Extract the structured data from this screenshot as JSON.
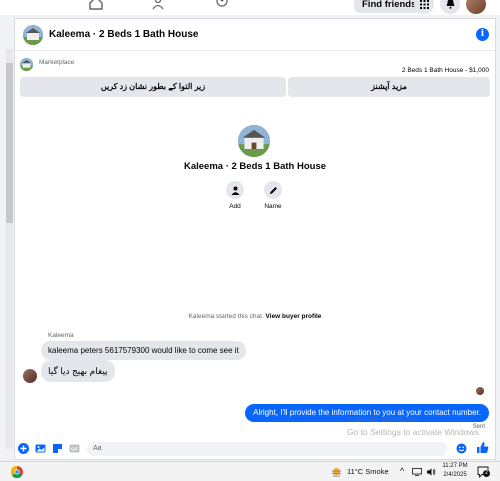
{
  "topbar": {
    "find_friends": "Find friends"
  },
  "chat": {
    "title": "Kaleema · 2 Beds 1 Bath House",
    "marketplace_label": "Marketplace",
    "listing_price": "2 Beds 1 Bath House - $1,000",
    "btn_left": "زیر التوا کے بطور نشان زد کریں",
    "btn_right": "مزید آپشنز",
    "profile_title": "Kaleema · 2 Beds 1 Bath House",
    "add_label": "Add",
    "name_label": "Name",
    "started_prefix": "Kaleema started this chat.",
    "view_profile": "View buyer profile",
    "sender_name": "Kaleema",
    "msg1": "kaleema peters 5617579300 would like to come see it",
    "msg2": "پیغام بھیج دیا گیا",
    "msg_out": "Alright, I'll provide the information to you at your contact number.",
    "sent_label": "Sent",
    "input_placeholder": "Aa",
    "watermark_title": "Activate Windows",
    "watermark_sub": "Go to Settings to activate Windows."
  },
  "taskbar": {
    "weather": "11°C  Smoke",
    "time": "11:27 PM",
    "date": "2/4/2025",
    "notif_count": "2"
  },
  "colors": {
    "accent": "#0866ff",
    "bubble_in": "#e4e6eb"
  }
}
